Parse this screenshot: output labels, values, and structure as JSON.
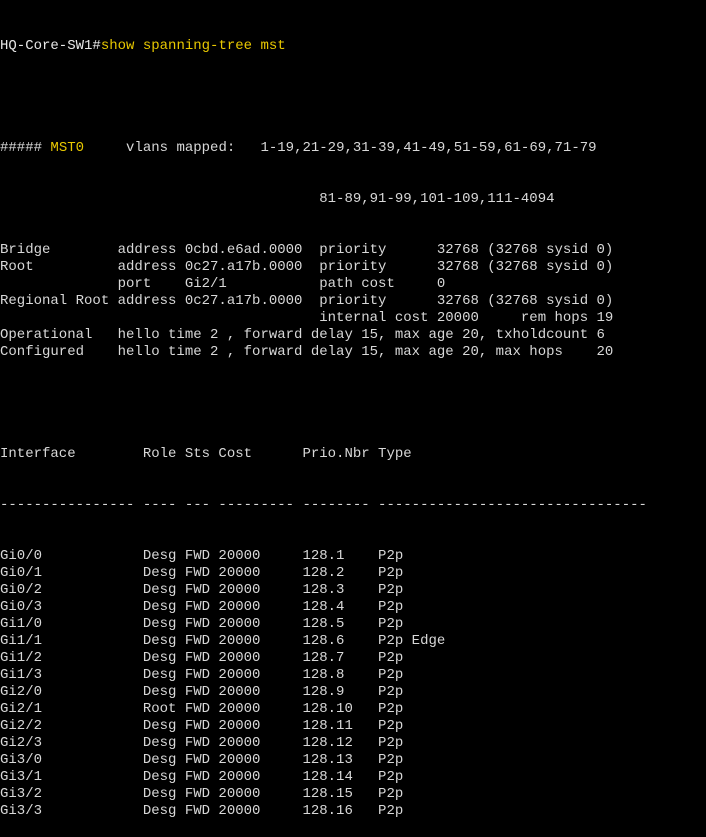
{
  "colors": {
    "background": "#000000",
    "text": "#d8d8d8",
    "highlight": "#e8c800"
  },
  "prompt": {
    "host": "HQ-Core-SW1#",
    "command": "show spanning-tree mst"
  },
  "mst": {
    "hashes": "##### ",
    "instance": "MST0",
    "vlans_label": "     vlans mapped:   ",
    "vlans_line1": "1-19,21-29,31-39,41-49,51-59,61-69,71-79",
    "vlans_line2": "                                      81-89,91-99,101-109,111-4094"
  },
  "summary_lines": [
    "Bridge        address 0cbd.e6ad.0000  priority      32768 (32768 sysid 0)",
    "Root          address 0c27.a17b.0000  priority      32768 (32768 sysid 0)",
    "              port    Gi2/1           path cost     0",
    "Regional Root address 0c27.a17b.0000  priority      32768 (32768 sysid 0)",
    "                                      internal cost 20000     rem hops 19",
    "Operational   hello time 2 , forward delay 15, max age 20, txholdcount 6",
    "Configured    hello time 2 , forward delay 15, max age 20, max hops    20"
  ],
  "table": {
    "header": "Interface        Role Sts Cost      Prio.Nbr Type",
    "separator": "---------------- ---- --- --------- -------- --------------------------------",
    "rows": [
      {
        "interface": "Gi0/0",
        "role": "Desg",
        "sts": "FWD",
        "cost": "20000",
        "prio": "128.1",
        "type": "P2p"
      },
      {
        "interface": "Gi0/1",
        "role": "Desg",
        "sts": "FWD",
        "cost": "20000",
        "prio": "128.2",
        "type": "P2p"
      },
      {
        "interface": "Gi0/2",
        "role": "Desg",
        "sts": "FWD",
        "cost": "20000",
        "prio": "128.3",
        "type": "P2p"
      },
      {
        "interface": "Gi0/3",
        "role": "Desg",
        "sts": "FWD",
        "cost": "20000",
        "prio": "128.4",
        "type": "P2p"
      },
      {
        "interface": "Gi1/0",
        "role": "Desg",
        "sts": "FWD",
        "cost": "20000",
        "prio": "128.5",
        "type": "P2p"
      },
      {
        "interface": "Gi1/1",
        "role": "Desg",
        "sts": "FWD",
        "cost": "20000",
        "prio": "128.6",
        "type": "P2p Edge"
      },
      {
        "interface": "Gi1/2",
        "role": "Desg",
        "sts": "FWD",
        "cost": "20000",
        "prio": "128.7",
        "type": "P2p"
      },
      {
        "interface": "Gi1/3",
        "role": "Desg",
        "sts": "FWD",
        "cost": "20000",
        "prio": "128.8",
        "type": "P2p"
      },
      {
        "interface": "Gi2/0",
        "role": "Desg",
        "sts": "FWD",
        "cost": "20000",
        "prio": "128.9",
        "type": "P2p"
      },
      {
        "interface": "Gi2/1",
        "role": "Root",
        "sts": "FWD",
        "cost": "20000",
        "prio": "128.10",
        "type": "P2p"
      },
      {
        "interface": "Gi2/2",
        "role": "Desg",
        "sts": "FWD",
        "cost": "20000",
        "prio": "128.11",
        "type": "P2p"
      },
      {
        "interface": "Gi2/3",
        "role": "Desg",
        "sts": "FWD",
        "cost": "20000",
        "prio": "128.12",
        "type": "P2p"
      },
      {
        "interface": "Gi3/0",
        "role": "Desg",
        "sts": "FWD",
        "cost": "20000",
        "prio": "128.13",
        "type": "P2p"
      },
      {
        "interface": "Gi3/1",
        "role": "Desg",
        "sts": "FWD",
        "cost": "20000",
        "prio": "128.14",
        "type": "P2p"
      },
      {
        "interface": "Gi3/2",
        "role": "Desg",
        "sts": "FWD",
        "cost": "20000",
        "prio": "128.15",
        "type": "P2p"
      },
      {
        "interface": "Gi3/3",
        "role": "Desg",
        "sts": "FWD",
        "cost": "20000",
        "prio": "128.16",
        "type": "P2p"
      }
    ]
  }
}
